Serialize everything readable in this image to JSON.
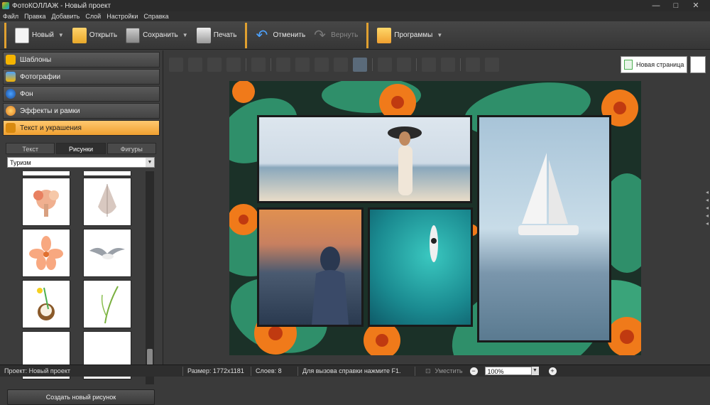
{
  "window": {
    "title": "ФотоКОЛЛАЖ - Новый проект",
    "controls": [
      "—",
      "□",
      "✕"
    ]
  },
  "menu": [
    "Файл",
    "Правка",
    "Добавить",
    "Слой",
    "Настройки",
    "Справка"
  ],
  "toolbar": {
    "new_label": "Новый",
    "open_label": "Открыть",
    "save_label": "Сохранить",
    "print_label": "Печать",
    "undo_label": "Отменить",
    "redo_label": "Вернуть",
    "programs_label": "Программы",
    "dropdown_glyph": "▼"
  },
  "sidebar": {
    "sections": [
      "Шаблоны",
      "Фотографии",
      "Фон",
      "Эффекты и рамки",
      "Текст и украшения"
    ],
    "active_section": "Текст и украшения",
    "subtabs": [
      "Текст",
      "Рисунки",
      "Фигуры"
    ],
    "active_subtab": "Рисунки",
    "category": "Туризм",
    "category_arrow": "▼",
    "thumbnails": [
      "coral",
      "seashell",
      "flower",
      "seagull",
      "cocktail",
      "grass"
    ],
    "create_label": "Создать новый рисунок"
  },
  "page_toolbar": {
    "new_page_label": "Новая страница"
  },
  "status": {
    "project": "Проект:  Новый проект",
    "size": "Размер:  1772x1181",
    "layers": "Слоев:  8",
    "help": "Для вызова справки нажмите F1.",
    "fit_label": "Уместить",
    "zoom_value": "100%",
    "zoom_minus": "−",
    "zoom_plus": "+",
    "zoom_arrow": "▼"
  },
  "colors": {
    "accent": "#f0a030",
    "canvas_bg": "#1e3a2e",
    "leaf": "#2f8f6a",
    "flower": "#f07a1a"
  }
}
